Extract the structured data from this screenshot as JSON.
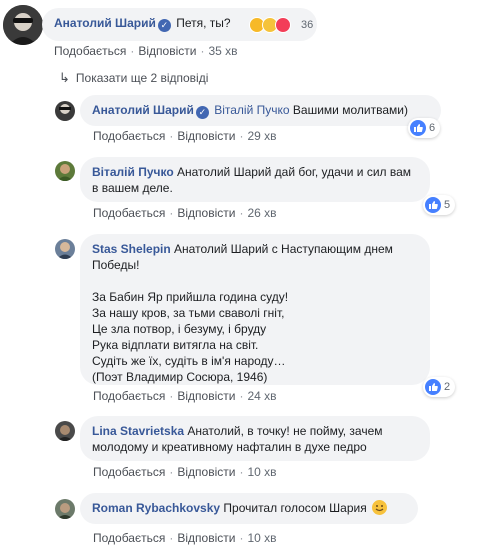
{
  "action_like": "Подобається",
  "action_reply": "Відповісти",
  "show_more": "Показати ще 2 відповіді",
  "colors": {
    "link": "#385898",
    "bubble": "#f2f3f5",
    "like": "#4680ff"
  },
  "main_comment": {
    "author": "Анатолий Шарий",
    "text": "Петя, ты?",
    "reaction_count": "36",
    "reactions": [
      "haha-icon",
      "wow-icon",
      "love-icon"
    ],
    "time": "35 хв"
  },
  "replies": [
    {
      "author": "Анатолий Шарий",
      "mention": "Віталій Пучко",
      "text": "Вашими молитвами)",
      "likes": "6",
      "time": "29 хв"
    },
    {
      "author": "Віталій Пучко",
      "mention": "",
      "text": "Анатолий Шарий дай бог, удачи и сил вам в вашем деле.",
      "likes": "5",
      "time": "26 хв"
    },
    {
      "author": "Stas Shelepin",
      "text": "Анатолий Шарий с Наступающим днем Победы!",
      "poem": [
        "За Бабин Яр прийшла година суду!",
        "За нашу кров, за тьми сваволі гніт,",
        "Це зла потвор, і безуму, і бруду",
        "Рука відплати витягла на світ.",
        "Судіть же їх, судіть в ім'я народу…",
        "(Поэт Владимир Сосюра, 1946)"
      ],
      "likes": "2",
      "time": "24 хв"
    },
    {
      "author": "Lina Stavrietska",
      "text": "Анатолий, в точку! не пойму, зачем молодому и креативному нафталин в духе педро",
      "time": "10 хв"
    },
    {
      "author": "Roman Rybachkovsky",
      "text": "Прочитал голосом Шария",
      "time": "10 хв"
    }
  ]
}
